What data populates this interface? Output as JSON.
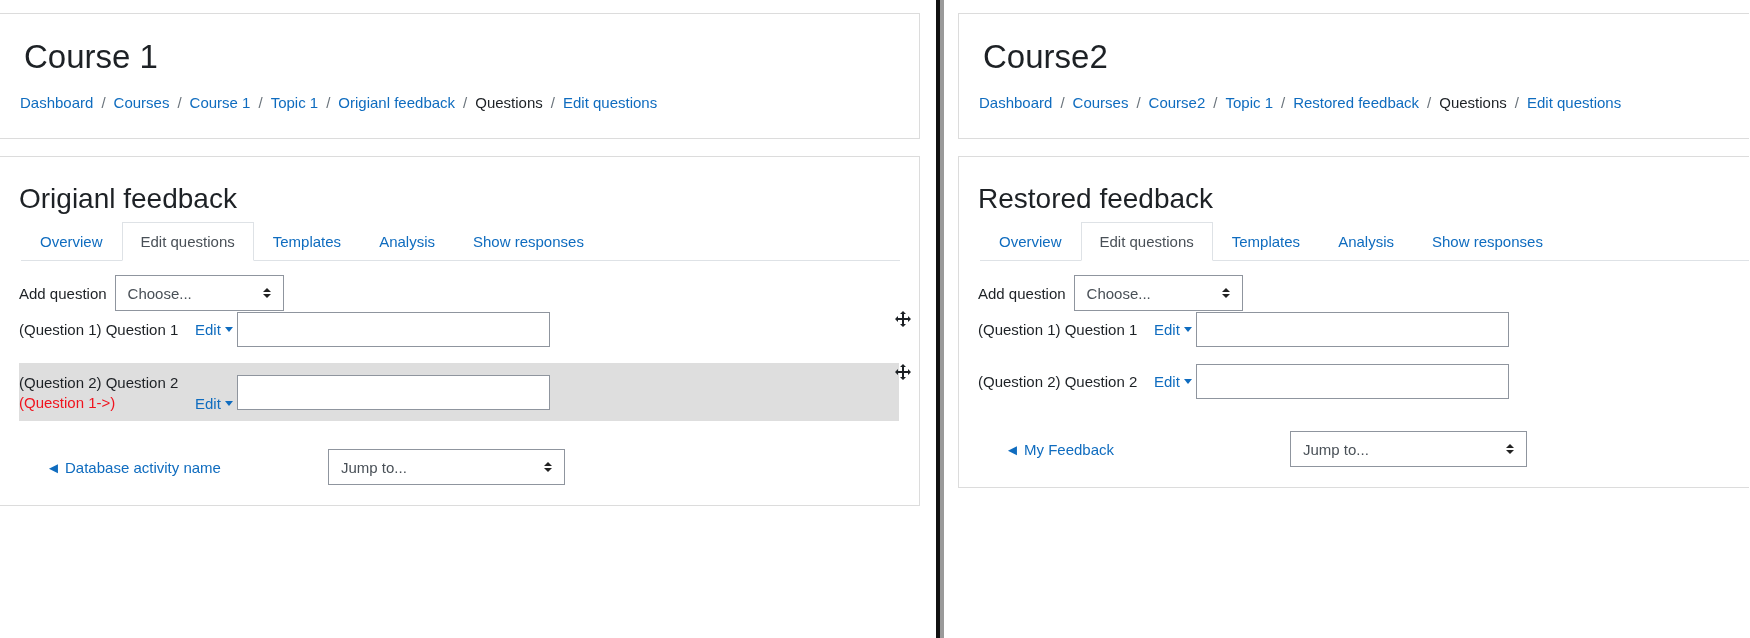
{
  "panes": [
    {
      "course_title": "Course 1",
      "breadcrumb_separator": "/",
      "breadcrumbs": [
        {
          "label": "Dashboard",
          "link": true
        },
        {
          "label": "Courses",
          "link": true
        },
        {
          "label": "Course 1",
          "link": true
        },
        {
          "label": "Topic 1",
          "link": true
        },
        {
          "label": "Origianl feedback",
          "link": true
        },
        {
          "label": "Questions",
          "link": false
        },
        {
          "label": "Edit questions",
          "link": true
        }
      ],
      "activity_title": "Origianl feedback",
      "tabs": [
        {
          "label": "Overview",
          "selected": false
        },
        {
          "label": "Edit questions",
          "selected": true
        },
        {
          "label": "Templates",
          "selected": false
        },
        {
          "label": "Analysis",
          "selected": false
        },
        {
          "label": "Show responses",
          "selected": false
        }
      ],
      "add_question": {
        "label": "Add question",
        "select": "Choose..."
      },
      "questions": [
        {
          "label": "(Question 1) Question 1",
          "edit": "Edit",
          "move_handle": true,
          "highlighted": false
        },
        {
          "label": "(Question 2) Question 2",
          "dependency": "(Question 1->)",
          "edit": "Edit",
          "move_handle": true,
          "highlighted": true
        }
      ],
      "footer": {
        "link": "◄ Database activity name",
        "jump": "Jump to..."
      }
    },
    {
      "course_title": "Course2",
      "breadcrumb_separator": "/",
      "breadcrumbs": [
        {
          "label": "Dashboard",
          "link": true
        },
        {
          "label": "Courses",
          "link": true
        },
        {
          "label": "Course2",
          "link": true
        },
        {
          "label": "Topic 1",
          "link": true
        },
        {
          "label": "Restored feedback",
          "link": true
        },
        {
          "label": "Questions",
          "link": false
        },
        {
          "label": "Edit questions",
          "link": true
        }
      ],
      "activity_title": "Restored feedback",
      "tabs": [
        {
          "label": "Overview",
          "selected": false
        },
        {
          "label": "Edit questions",
          "selected": true
        },
        {
          "label": "Templates",
          "selected": false
        },
        {
          "label": "Analysis",
          "selected": false
        },
        {
          "label": "Show responses",
          "selected": false
        }
      ],
      "add_question": {
        "label": "Add question",
        "select": "Choose..."
      },
      "questions": [
        {
          "label": "(Question 1) Question 1",
          "edit": "Edit",
          "move_handle": false,
          "highlighted": false
        },
        {
          "label": "(Question 2) Question 2",
          "edit": "Edit",
          "move_handle": false,
          "highlighted": false
        }
      ],
      "footer": {
        "link": "◄ My Feedback",
        "jump": "Jump to..."
      }
    }
  ]
}
